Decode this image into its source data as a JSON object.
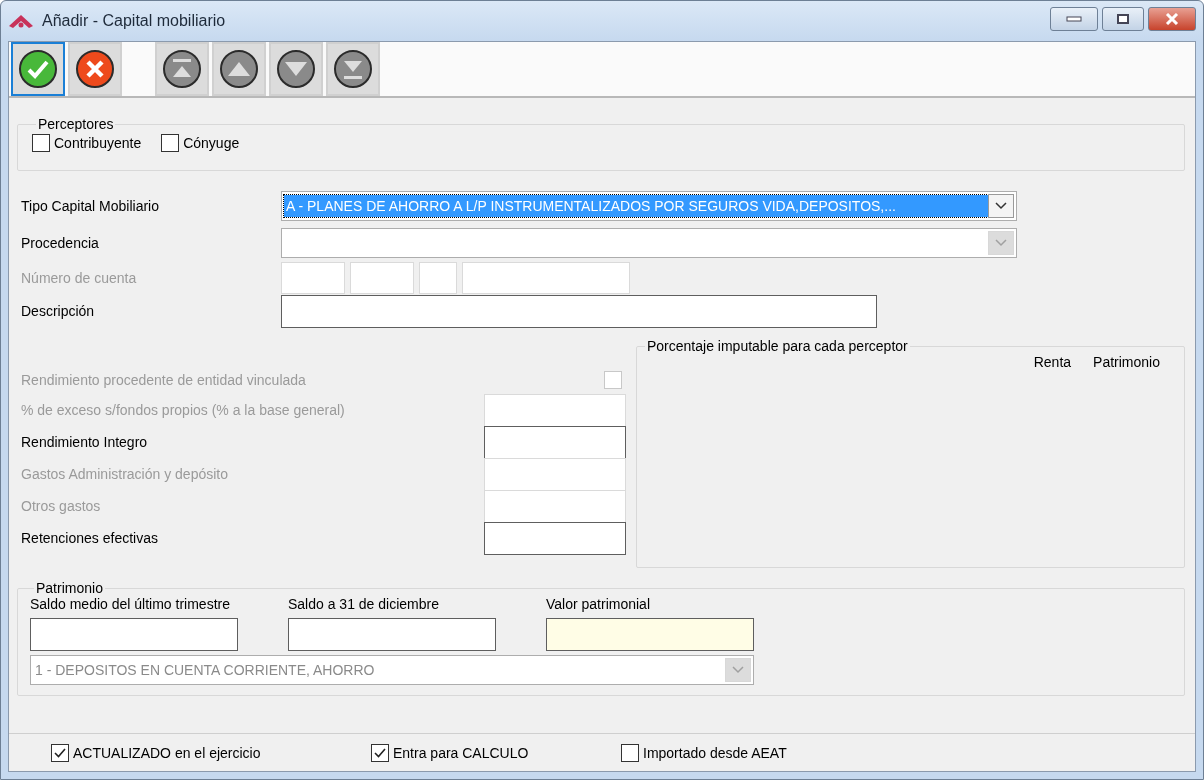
{
  "window": {
    "title": "Añadir  - Capital mobiliario"
  },
  "toolbar": [
    {
      "kind": "accept",
      "focused": true,
      "disabled": false
    },
    {
      "kind": "cancel",
      "focused": false,
      "disabled": false
    },
    {
      "kind": "first",
      "focused": false,
      "disabled": true
    },
    {
      "kind": "up",
      "focused": false,
      "disabled": true
    },
    {
      "kind": "down",
      "focused": false,
      "disabled": true
    },
    {
      "kind": "last",
      "focused": false,
      "disabled": true
    }
  ],
  "perceptores": {
    "title": "Perceptores",
    "options": [
      {
        "label": "Contribuyente",
        "checked": false
      },
      {
        "label": "Cónyuge",
        "checked": false
      }
    ]
  },
  "main_fields": [
    {
      "kind": "combo",
      "label": "Tipo Capital Mobiliario",
      "value": "A - PLANES DE AHORRO A L/P INSTRUMENTALIZADOS POR SEGUROS VIDA,DEPOSITOS,...",
      "selected": true,
      "disabled": false
    },
    {
      "kind": "combo",
      "label": "Procedencia",
      "disabled": true
    },
    {
      "kind": "account",
      "label": "Número de cuenta",
      "disabled": true
    },
    {
      "kind": "input",
      "label": "Descripción",
      "disabled": false
    }
  ],
  "rendimiento_fields": [
    {
      "kind": "checkbox",
      "label": "Rendimiento procedente de entidad vinculada",
      "checked": false,
      "disabled": true
    },
    {
      "kind": "input",
      "label": "% de exceso s/fondos propios (% a la base general)",
      "disabled": true
    },
    {
      "kind": "input",
      "label": "Rendimiento Integro",
      "disabled": false
    },
    {
      "kind": "input",
      "label": "Gastos Administración y depósito",
      "disabled": true
    },
    {
      "kind": "input",
      "label": "Otros gastos",
      "disabled": true
    },
    {
      "kind": "input",
      "label": "Retenciones efectivas",
      "disabled": false
    }
  ],
  "porcentaje": {
    "title": "Porcentaje imputable para cada perceptor",
    "columns": [
      "Renta",
      "Patrimonio"
    ]
  },
  "patrimonio": {
    "title": "Patrimonio",
    "fields": [
      {
        "label": "Saldo medio del último trimestre",
        "readonly": false
      },
      {
        "label": "Saldo a 31 de diciembre",
        "readonly": false
      },
      {
        "label": "Valor patrimonial",
        "readonly": true
      }
    ],
    "combo": {
      "value": "1 - DEPOSITOS EN CUENTA CORRIENTE, AHORRO",
      "disabled": true
    }
  },
  "footer": [
    {
      "label": "ACTUALIZADO en el ejercicio",
      "checked": true
    },
    {
      "label": "Entra para CALCULO",
      "checked": true
    },
    {
      "label": "Importado desde AEAT",
      "checked": false
    }
  ]
}
